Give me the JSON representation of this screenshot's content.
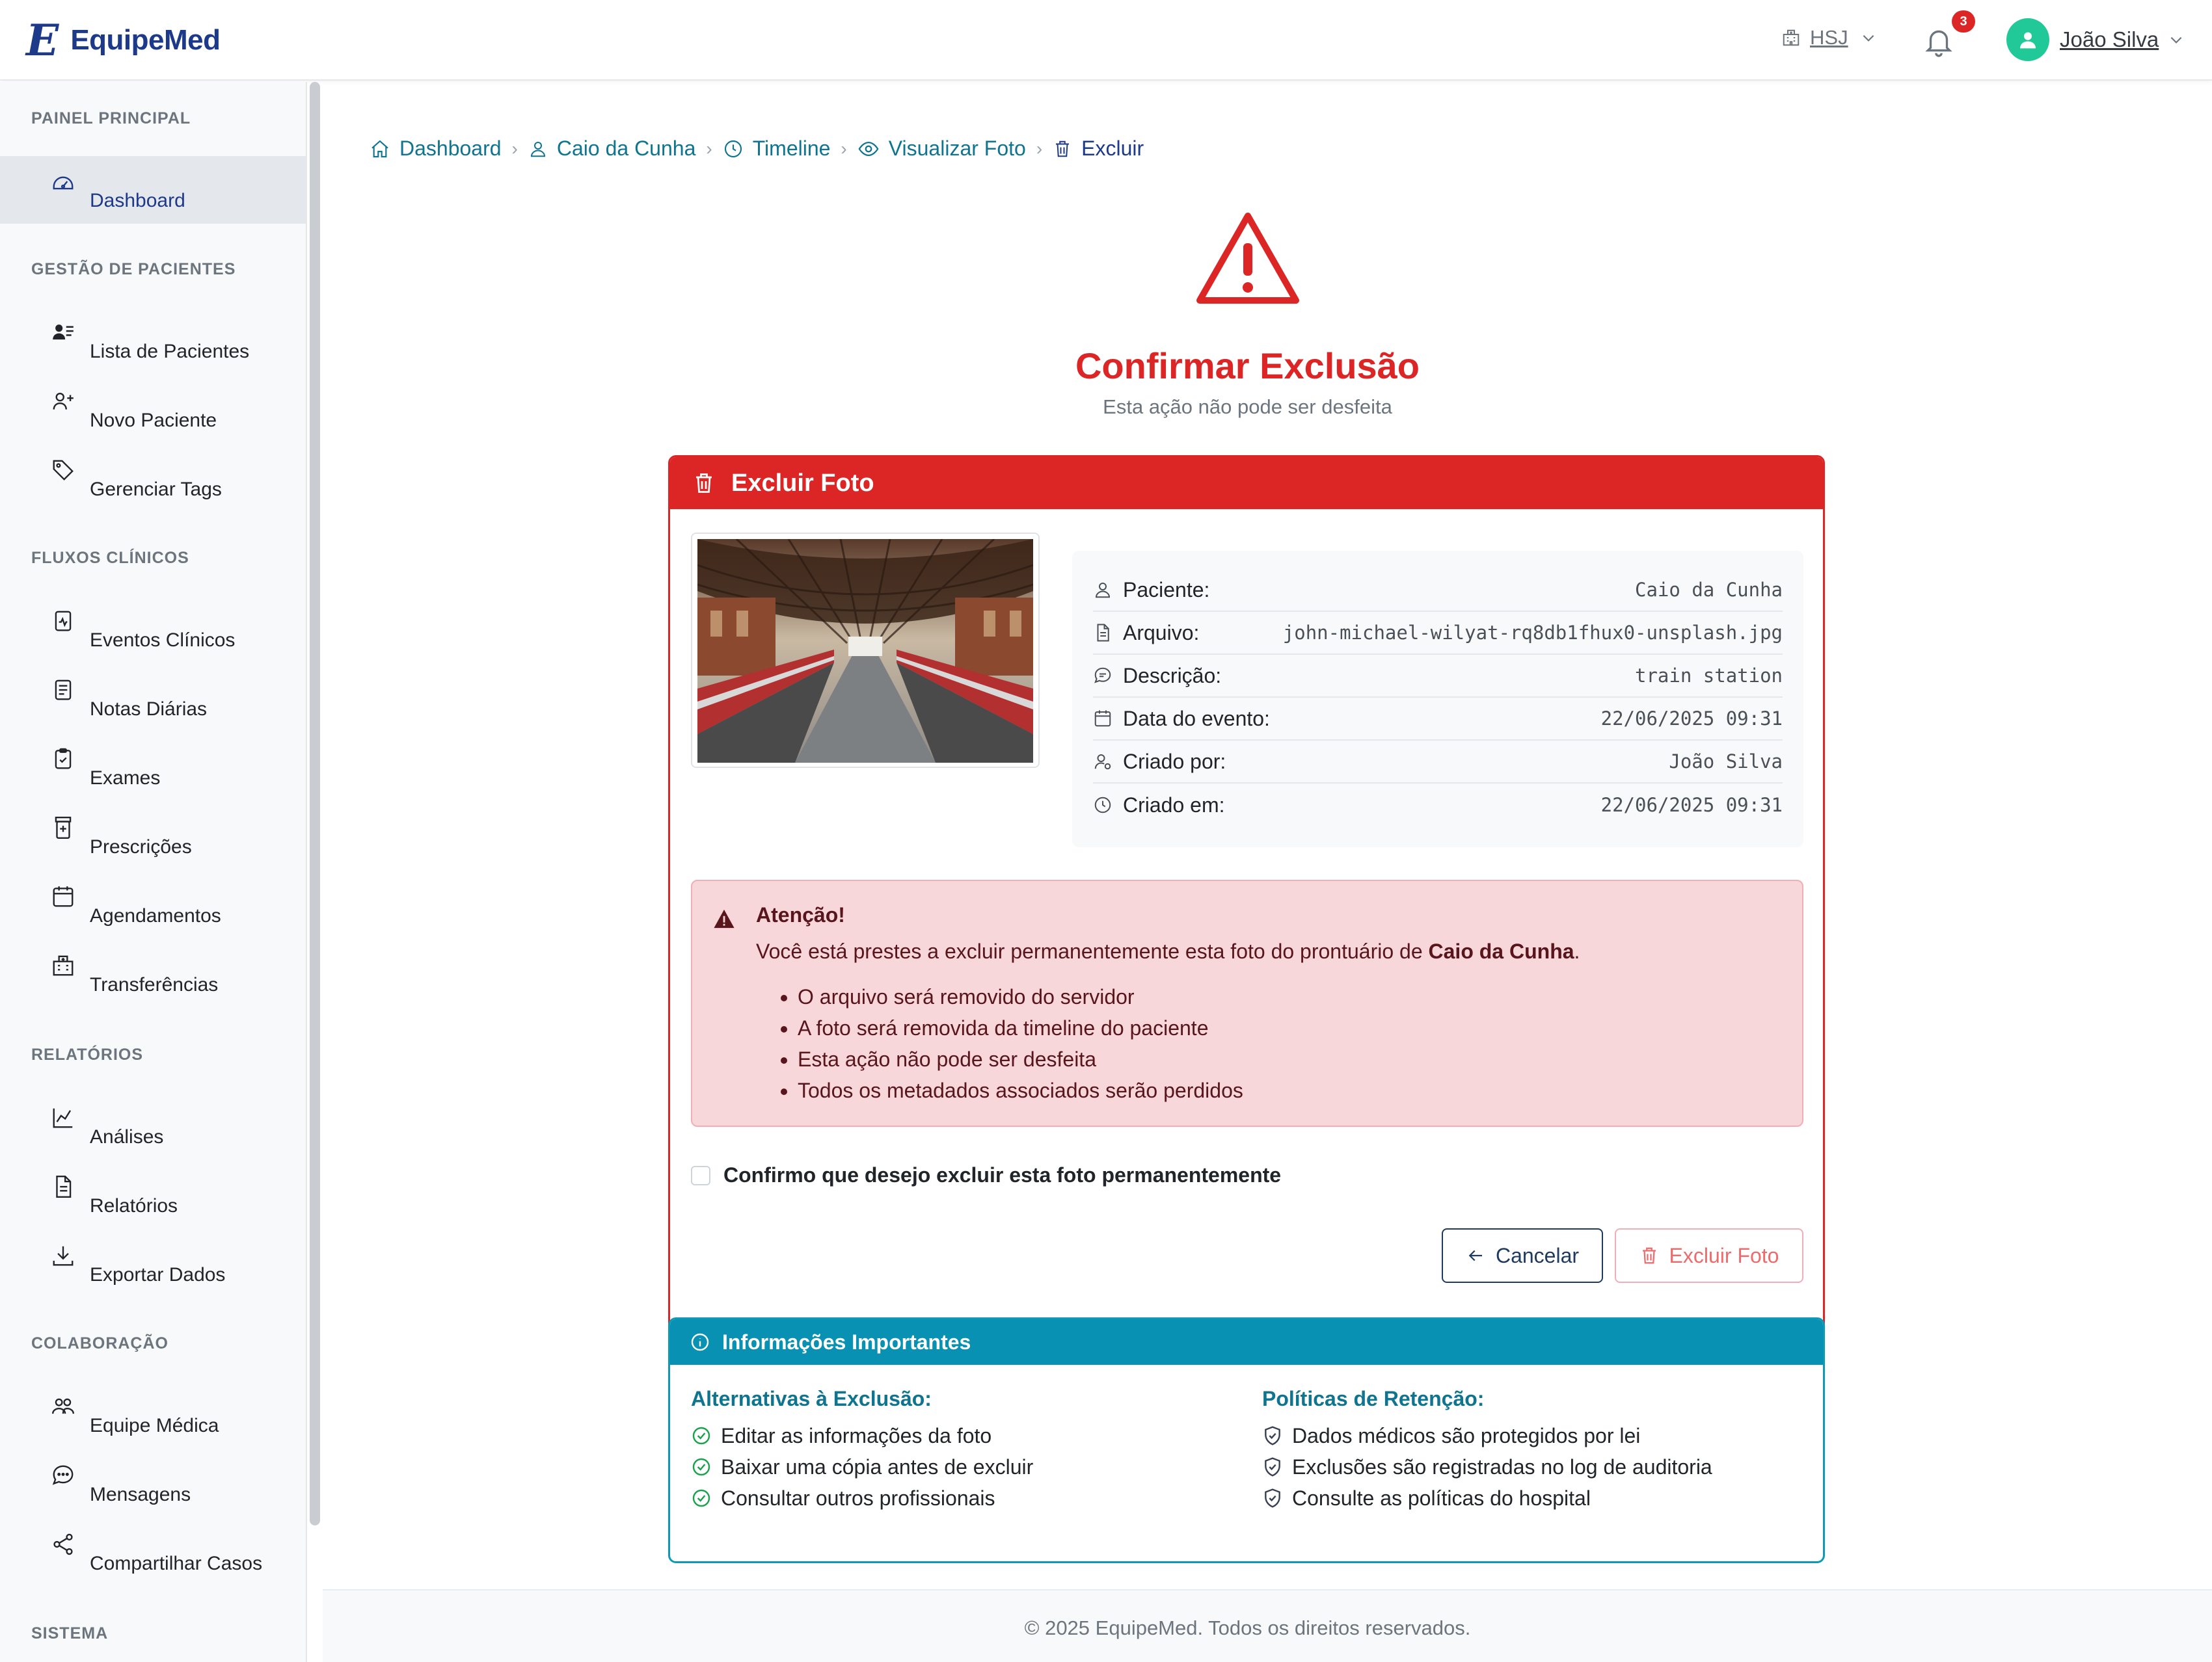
{
  "brand": {
    "name": "EquipeMed",
    "logo_letter": "E",
    "color": "#1d3a8a"
  },
  "topbar": {
    "hospital": "HSJ",
    "notifications_count": "3",
    "user_name": "João Silva",
    "avatar_color": "#20c997"
  },
  "sidebar": {
    "sections": [
      {
        "title": "PAINEL PRINCIPAL",
        "items": [
          {
            "label": "Dashboard",
            "icon": "dashboard-icon",
            "active": true
          }
        ]
      },
      {
        "title": "GESTÃO DE PACIENTES",
        "items": [
          {
            "label": "Lista de Pacientes",
            "icon": "patients-list-icon"
          },
          {
            "label": "Novo Paciente",
            "icon": "user-plus-icon"
          },
          {
            "label": "Gerenciar Tags",
            "icon": "tags-icon"
          }
        ]
      },
      {
        "title": "FLUXOS CLÍNICOS",
        "items": [
          {
            "label": "Eventos Clínicos",
            "icon": "clinical-events-icon"
          },
          {
            "label": "Notas Diárias",
            "icon": "daily-notes-icon"
          },
          {
            "label": "Exames",
            "icon": "clipboard-check-icon"
          },
          {
            "label": "Prescrições",
            "icon": "prescription-icon"
          },
          {
            "label": "Agendamentos",
            "icon": "calendar-icon"
          },
          {
            "label": "Transferências",
            "icon": "hospital-icon"
          }
        ]
      },
      {
        "title": "RELATÓRIOS",
        "items": [
          {
            "label": "Análises",
            "icon": "chart-line-icon"
          },
          {
            "label": "Relatórios",
            "icon": "document-icon"
          },
          {
            "label": "Exportar Dados",
            "icon": "download-icon"
          }
        ]
      },
      {
        "title": "COLABORAÇÃO",
        "items": [
          {
            "label": "Equipe Médica",
            "icon": "team-icon"
          },
          {
            "label": "Mensagens",
            "icon": "chat-icon"
          },
          {
            "label": "Compartilhar Casos",
            "icon": "share-icon"
          }
        ]
      },
      {
        "title": "SISTEMA",
        "items": []
      }
    ]
  },
  "breadcrumb": [
    {
      "label": "Dashboard",
      "icon": "home-icon"
    },
    {
      "label": "Caio da Cunha",
      "icon": "person-icon"
    },
    {
      "label": "Timeline",
      "icon": "clock-icon"
    },
    {
      "label": "Visualizar Foto",
      "icon": "eye-icon"
    },
    {
      "label": "Excluir",
      "icon": "trash-icon"
    }
  ],
  "header": {
    "title": "Confirmar Exclusão",
    "subtitle": "Esta ação não pode ser desfeita",
    "danger_color": "#dc2626"
  },
  "delete_card": {
    "title": "Excluir Foto",
    "photo_alt": "train station",
    "details": [
      {
        "label": "Paciente:",
        "value": "Caio da Cunha",
        "icon": "person-icon"
      },
      {
        "label": "Arquivo:",
        "value": "john-michael-wilyat-rq8db1fhux0-unsplash.jpg",
        "icon": "file-icon"
      },
      {
        "label": "Descrição:",
        "value": "train station",
        "icon": "chat-icon"
      },
      {
        "label": "Data do evento:",
        "value": "22/06/2025 09:31",
        "icon": "calendar-icon"
      },
      {
        "label": "Criado por:",
        "value": "João Silva",
        "icon": "user-gear-icon"
      },
      {
        "label": "Criado em:",
        "value": "22/06/2025 09:31",
        "icon": "clock-icon"
      }
    ],
    "alert": {
      "title": "Atenção!",
      "text_before": "Você está prestes a excluir permanentemente esta foto do prontuário de ",
      "patient": "Caio da Cunha",
      "text_after": ".",
      "items": [
        "O arquivo será removido do servidor",
        "A foto será removida da timeline do paciente",
        "Esta ação não pode ser desfeita",
        "Todos os metadados associados serão perdidos"
      ]
    },
    "confirm_label": "Confirmo que desejo excluir esta foto permanentemente",
    "confirm_checked": false,
    "cancel_label": "Cancelar",
    "delete_label": "Excluir Foto"
  },
  "info_card": {
    "title": "Informações Importantes",
    "accent_color": "#0891b2",
    "alternatives": {
      "title": "Alternativas à Exclusão:",
      "items": [
        "Editar as informações da foto",
        "Baixar uma cópia antes de excluir",
        "Consultar outros profissionais"
      ]
    },
    "policies": {
      "title": "Políticas de Retenção:",
      "items": [
        "Dados médicos são protegidos por lei",
        "Exclusões são registradas no log de auditoria",
        "Consulte as políticas do hospital"
      ]
    }
  },
  "footer": {
    "text": "© 2025 EquipeMed. Todos os direitos reservados."
  }
}
